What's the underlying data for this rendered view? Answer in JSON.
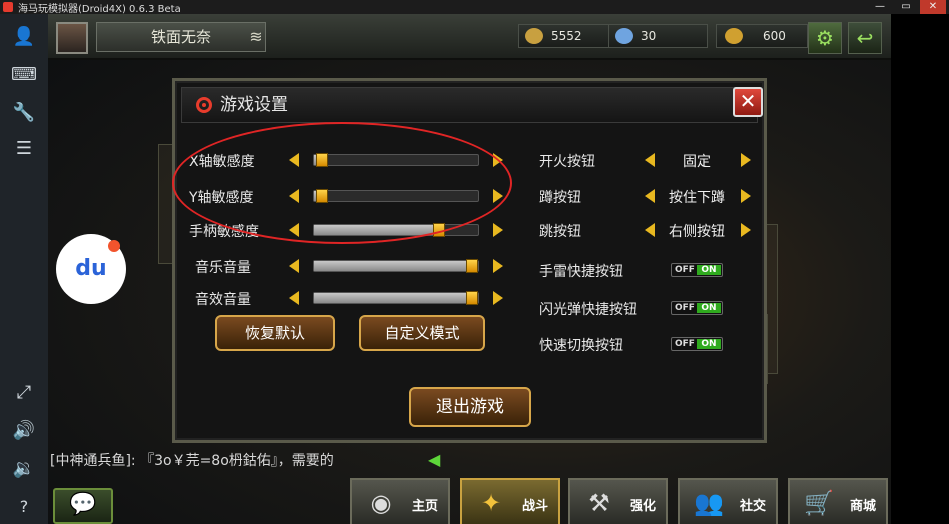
{
  "window": {
    "title": "海马玩模拟器(Droid4X) 0.6.3 Beta",
    "min": "—",
    "restore": "▭",
    "close": "✕"
  },
  "toolbar": {
    "icons": [
      "user-icon",
      "keyboard-icon",
      "wrench-icon",
      "menu-icon",
      "fullscreen-icon",
      "volume-up-icon",
      "volume-down-icon",
      "help-icon"
    ]
  },
  "player": {
    "name": "铁面无奈"
  },
  "resources": [
    {
      "name": "gold",
      "value": "5552",
      "color": "#c8a040"
    },
    {
      "name": "diamond",
      "value": "30",
      "color": "#6fa4e0"
    },
    {
      "name": "honor",
      "value": "600",
      "color": "#d0a030"
    }
  ],
  "settings": {
    "title": "游戏设置",
    "close": "✕",
    "sliders": [
      {
        "label": "X轴敏感度",
        "level": 0.04
      },
      {
        "label": "Y轴敏感度",
        "level": 0.04
      },
      {
        "label": "手柄敏感度",
        "level": 0.8
      },
      {
        "label": "音乐音量",
        "level": 1.0
      },
      {
        "label": "音效音量",
        "level": 1.0
      }
    ],
    "selectors": [
      {
        "label": "开火按钮",
        "value": "固定"
      },
      {
        "label": "蹲按钮",
        "value": "按住下蹲"
      },
      {
        "label": "跳按钮",
        "value": "右侧按钮"
      }
    ],
    "toggles": [
      {
        "label": "手雷快捷按钮",
        "off": "OFF",
        "on": "ON"
      },
      {
        "label": "闪光弹快捷按钮",
        "off": "OFF",
        "on": "ON"
      },
      {
        "label": "快速切换按钮",
        "off": "OFF",
        "on": "ON"
      }
    ],
    "buttons": {
      "reset": "恢复默认",
      "custom": "自定义模式",
      "exit": "退出游戏"
    }
  },
  "chat": {
    "text": "[中神通兵鱼]: 『3o￥芫=8o枬鈷佑』，需要的"
  },
  "nav": [
    {
      "label": "主页",
      "icon": "home-icon"
    },
    {
      "label": "战斗",
      "icon": "guns-icon"
    },
    {
      "label": "强化",
      "icon": "tools-icon"
    },
    {
      "label": "社交",
      "icon": "people-icon"
    },
    {
      "label": "商城",
      "icon": "cart-icon"
    }
  ],
  "accent": {
    "red": "#e02525",
    "gold": "#e8b820",
    "green": "#2faa1e"
  }
}
